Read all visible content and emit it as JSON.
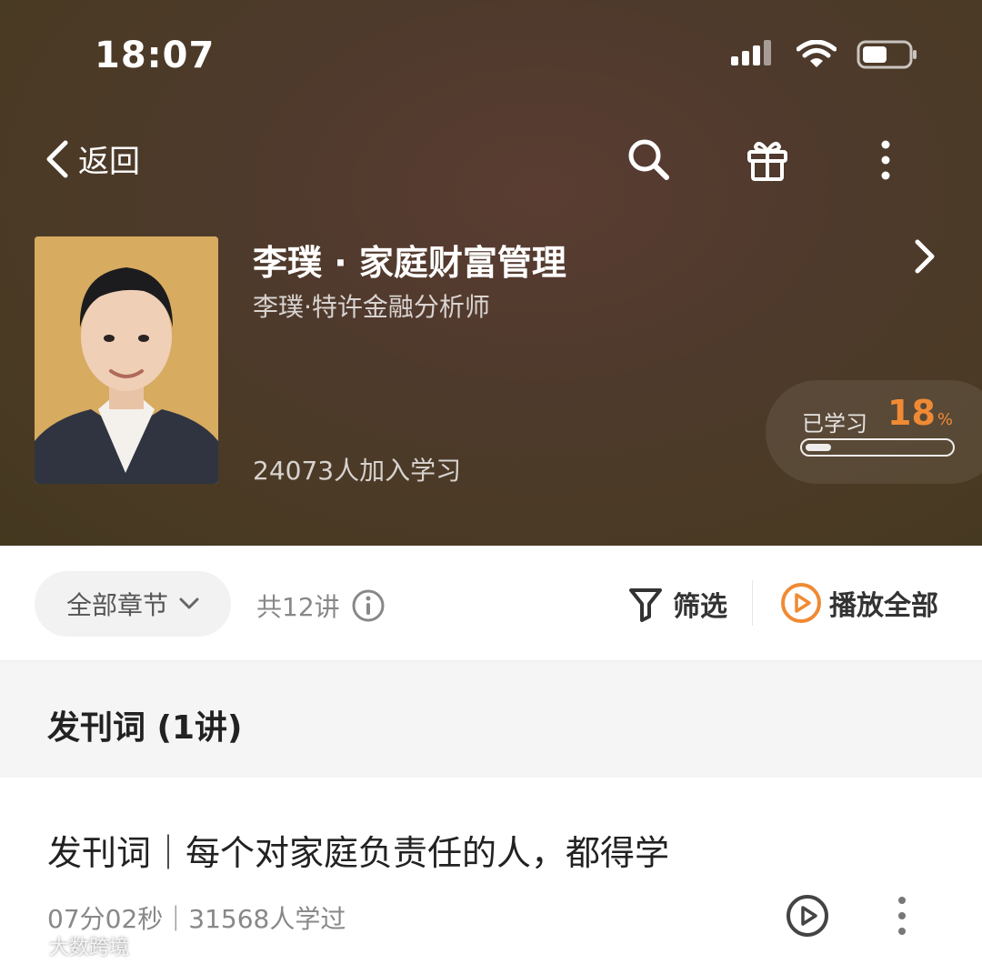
{
  "status_bar": {
    "time": "18:07"
  },
  "nav": {
    "back_label": "返回"
  },
  "course": {
    "title": "李璞 · 家庭财富管理",
    "author": "李璞·特许金融分析师",
    "learners": "24073人加入学习",
    "progress_label": "已学习",
    "progress_value": "18",
    "progress_unit": "%",
    "progress_fraction": 0.18
  },
  "toolbar": {
    "chapter_select": "全部章节",
    "lecture_count": "共12讲",
    "filter_label": "筛选",
    "play_all_label": "播放全部"
  },
  "section": {
    "title": "发刊词 (1讲)"
  },
  "episode": {
    "title": "发刊词｜每个对家庭负责任的人，都得学",
    "meta": "07分02秒｜31568人学过"
  },
  "watermark": {
    "text": "大数跨境"
  },
  "colors": {
    "accent": "#f08a34",
    "hero_bg": "#4a3a26"
  }
}
